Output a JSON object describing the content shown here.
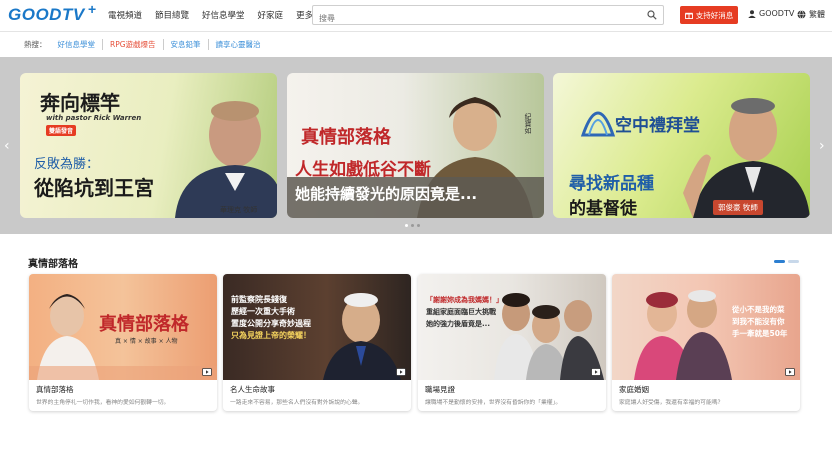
{
  "header": {
    "logo_text": "GOODTV",
    "logo_plus": "+",
    "nav": [
      "電視頻道",
      "節目總覽",
      "好信息學堂",
      "好家庭",
      "更多"
    ],
    "search_placeholder": "搜尋",
    "support_label": "支持好消息",
    "user_label": "GOODTV",
    "lang_label": "繁體"
  },
  "hotbar": {
    "label": "熱搜：",
    "links": [
      "好信息學堂",
      "RPG遊戲爆告",
      "安息鉛筆",
      "讀享心靈醫治"
    ]
  },
  "carousel": {
    "slides": [
      {
        "logo_title": "奔向標竿",
        "logo_sub": "with pastor Rick Warren",
        "badge": "雙語發音",
        "line1": "反敗為勝：",
        "line2": "從陷坑到王宮",
        "caption": "華理克 牧師"
      },
      {
        "logo_title": "真情部落格",
        "side_text": "紀寶如",
        "line1": "人生如戲低谷不斷",
        "line2": "她能持續發光的原因竟是..."
      },
      {
        "logo_title": "空中禮拜堂",
        "line1": "尋找新品種",
        "line2": "的基督徒",
        "caption": "郭俊豪 牧師"
      }
    ]
  },
  "section": {
    "title": "真情部落格",
    "cards": [
      {
        "overlay": "真情部落格",
        "overlay_sub": "真 × 情 × 故事 × 人物",
        "title": "真情部落格",
        "desc": "世界的主角停礼一切作我，看神的愛如何觀轉一切。"
      },
      {
        "overlay_lines": [
          "前監察院長錢復",
          "歷經一次重大手術",
          "置度公開分享奇妙過程",
          "只為見證上帝的榮耀！"
        ],
        "title": "名人生命故事",
        "desc": "一路走來不容易，那些名人們沒有對外訴說的心聲。"
      },
      {
        "overlay_lines": [
          "「謝謝妳成為我媽媽！」",
          "重組家庭面臨巨大挑戰",
          "她的強力後盾竟是..."
        ],
        "title": "職場見證",
        "desc": "讓職場不是勤懷的安排，世界沒有昏訴你的「業權」。"
      },
      {
        "overlay_lines": [
          "從小不是我的菜",
          "到我不能沒有你",
          "手一牽就是50年"
        ],
        "title": "家庭婚姻",
        "desc": "家庭讓人好受傷，我還有幸福的可能嗎？"
      }
    ]
  }
}
